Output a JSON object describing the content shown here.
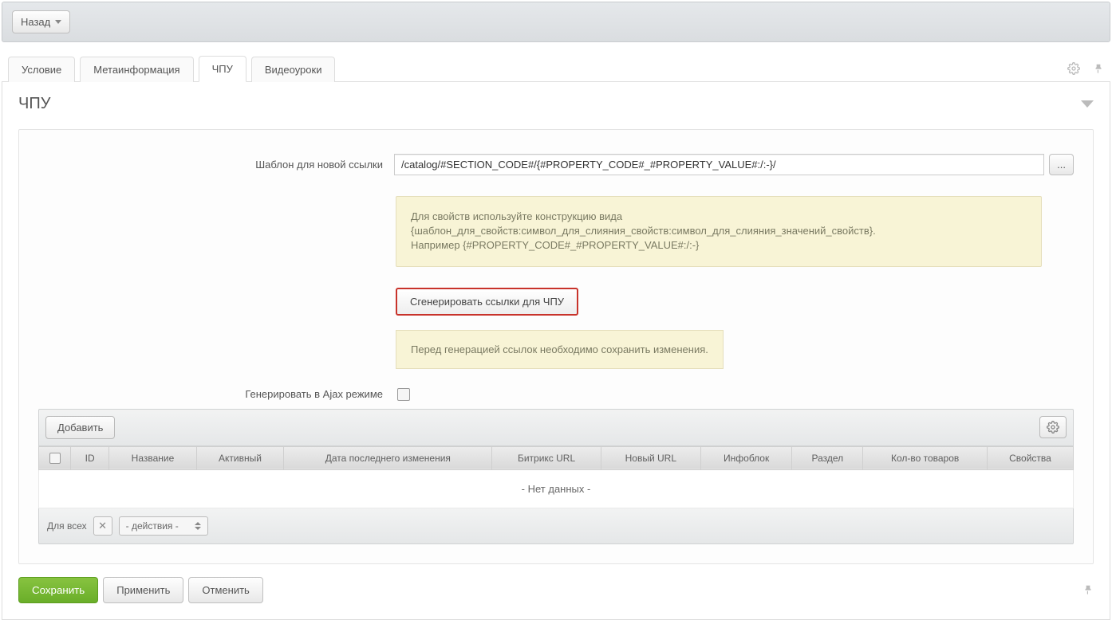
{
  "topbar": {
    "back_label": "Назад"
  },
  "tabs": [
    {
      "label": "Условие"
    },
    {
      "label": "Метаинформация"
    },
    {
      "label": "ЧПУ",
      "active": true
    },
    {
      "label": "Видеоуроки"
    }
  ],
  "panel": {
    "title": "ЧПУ",
    "template_label": "Шаблон для новой ссылки",
    "template_value": "/catalog/#SECTION_CODE#/{#PROPERTY_CODE#_#PROPERTY_VALUE#:/:-}/",
    "ellipsis": "...",
    "help_line1": "Для свойств используйте конструкцию вида",
    "help_line2": "{шаблон_для_свойств:символ_для_слияния_свойств:символ_для_слияния_значений_свойств}.",
    "help_line3": "Например {#PROPERTY_CODE#_#PROPERTY_VALUE#:/:-}",
    "generate_btn": "Сгенерировать ссылки для ЧПУ",
    "warn_text": "Перед генерацией ссылок необходимо сохранить изменения.",
    "ajax_label": "Генерировать в Ajax режиме"
  },
  "grid": {
    "add_btn": "Добавить",
    "headers": [
      "ID",
      "Название",
      "Активный",
      "Дата последнего изменения",
      "Битрикс URL",
      "Новый URL",
      "Инфоблок",
      "Раздел",
      "Кол-во товаров",
      "Свойства"
    ],
    "empty_text": "- Нет данных -",
    "for_all": "Для всех",
    "actions_placeholder": "- действия -"
  },
  "actions": {
    "save": "Сохранить",
    "apply": "Применить",
    "cancel": "Отменить"
  }
}
